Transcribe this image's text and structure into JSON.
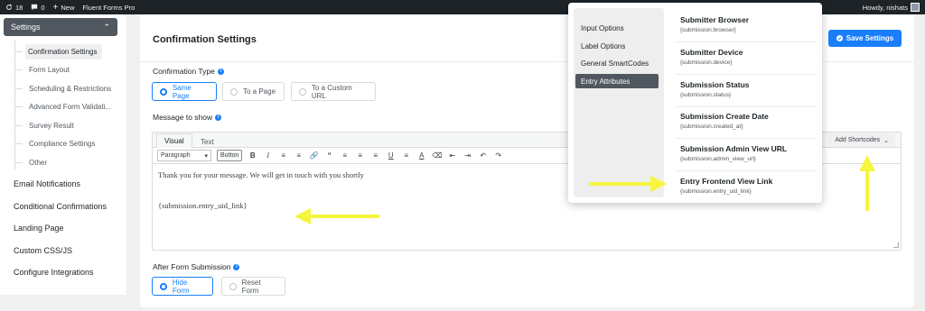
{
  "adminbar": {
    "updates": "18",
    "comments": "0",
    "new_label": "New",
    "site": "Fluent Forms Pro",
    "greeting": "Howdy, nishats"
  },
  "sidebar": {
    "head": "Settings",
    "sub_items": [
      "Confirmation Settings",
      "Form Layout",
      "Scheduling & Restrictions",
      "Advanced Form Validati...",
      "Survey Result",
      "Compliance Settings",
      "Other"
    ],
    "main_links": [
      "Email Notifications",
      "Conditional Confirmations",
      "Landing Page",
      "Custom CSS/JS",
      "Configure Integrations"
    ]
  },
  "main": {
    "title": "Confirmation Settings",
    "save_label": "Save Settings",
    "confirmation_type_label": "Confirmation Type",
    "confirmation_types": [
      "Same Page",
      "To a Page",
      "To a Custom URL"
    ],
    "message_label": "Message to show",
    "editor_tabs": [
      "Visual",
      "Text"
    ],
    "format_select": "Paragraph",
    "button_label": "Button",
    "add_shortcodes": "Add Shortcodes",
    "body_line1": "Thank you for your message. We will get in touch with you shortly",
    "body_line2": "{submission.entry_uid_link}",
    "after_submit_label": "After Form Submission",
    "after_options": [
      "Hide Form",
      "Reset Form"
    ]
  },
  "popup": {
    "categories": [
      "Input Options",
      "Label Options",
      "General SmartCodes",
      "Entry Attributes"
    ],
    "items": [
      {
        "title": "Submitter Browser",
        "code": "{submission.browser}"
      },
      {
        "title": "Submitter Device",
        "code": "{submission.device}"
      },
      {
        "title": "Submission Status",
        "code": "{submission.status}"
      },
      {
        "title": "Submission Create Date",
        "code": "{submission.created_at}"
      },
      {
        "title": "Submission Admin View URL",
        "code": "{submission.admin_view_url}"
      },
      {
        "title": "Entry Frontend View Link",
        "code": "{submission.entry_uid_link}"
      }
    ]
  },
  "colors": {
    "primary": "#1a7efb",
    "adminbar": "#1d2327",
    "arrow": "#f5f53d"
  }
}
